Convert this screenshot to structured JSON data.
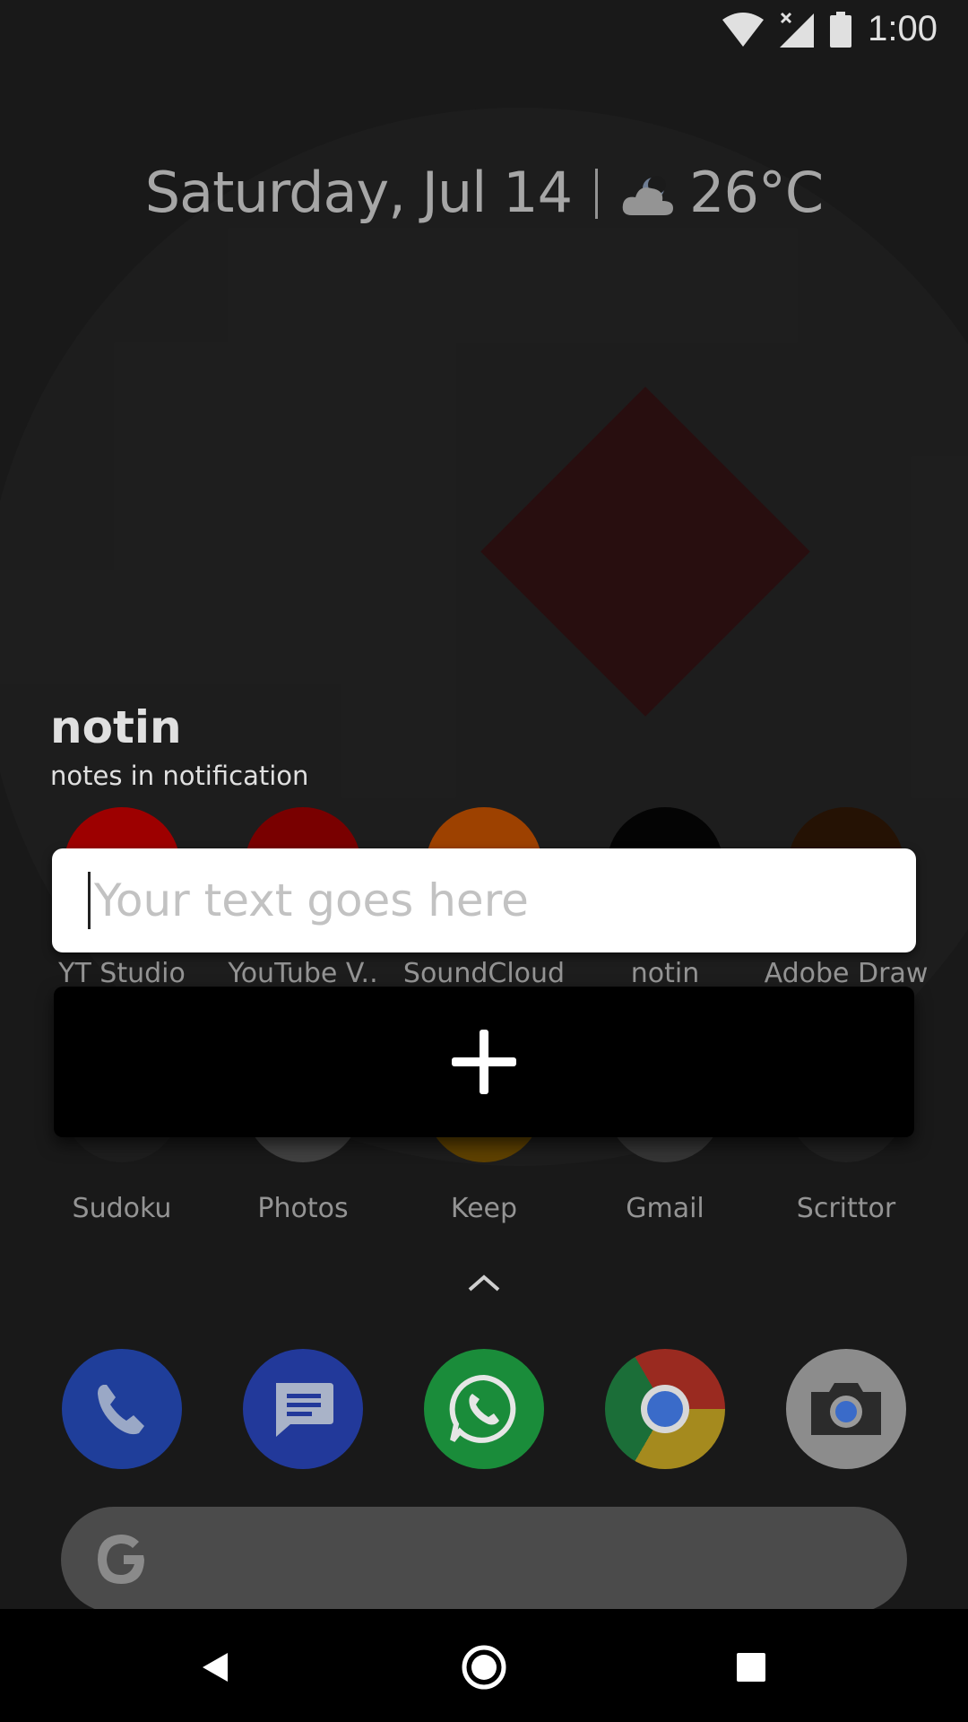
{
  "status_bar": {
    "time": "1:00",
    "icons": [
      "wifi-icon",
      "cellular-no-signal-icon",
      "battery-icon"
    ]
  },
  "at_a_glance": {
    "date": "Saturday, Jul 14",
    "weather_icon": "cloudy-night-icon",
    "temperature": "26°C"
  },
  "widget": {
    "title": "notin",
    "subtitle": "notes in notification",
    "input_placeholder": "Your text goes here",
    "input_value": "",
    "add_icon": "plus-icon"
  },
  "app_rows": [
    {
      "apps": [
        {
          "label": "YT Studio",
          "icon": "yt-studio-icon",
          "color": "#b30000"
        },
        {
          "label": "YouTube V..",
          "icon": "youtube-vanced-icon",
          "color": "#8a0000"
        },
        {
          "label": "SoundCloud",
          "icon": "soundcloud-icon",
          "color": "#b34a00"
        },
        {
          "label": "notin",
          "icon": "notin-icon",
          "color": "#050505"
        },
        {
          "label": "Adobe Draw",
          "icon": "adobe-draw-icon",
          "color": "#2b1505"
        }
      ]
    },
    {
      "apps": [
        {
          "label": "Sudoku",
          "icon": "sudoku-icon",
          "color": "#232323"
        },
        {
          "label": "Photos",
          "icon": "photos-icon",
          "color": "#4a4a4a"
        },
        {
          "label": "Keep",
          "icon": "keep-icon",
          "color": "#6b4a00"
        },
        {
          "label": "Gmail",
          "icon": "gmail-icon",
          "color": "#3d3d3d"
        },
        {
          "label": "Scrittor",
          "icon": "scrittor-icon",
          "color": "#262626"
        }
      ]
    }
  ],
  "app_drawer_handle_icon": "chevron-up-icon",
  "dock": [
    {
      "name": "phone",
      "icon": "phone-icon",
      "color": "#1f3e9a"
    },
    {
      "name": "messages",
      "icon": "messages-icon",
      "color": "#22399a"
    },
    {
      "name": "whatsapp",
      "icon": "whatsapp-icon",
      "color": "#1a8c3a"
    },
    {
      "name": "chrome",
      "icon": "chrome-icon",
      "color": "#1b6e38"
    },
    {
      "name": "camera",
      "icon": "camera-icon",
      "color": "#8c8c8c"
    }
  ],
  "search_bar": {
    "icon": "google-g-icon"
  },
  "nav_bar": {
    "back": "back-icon",
    "home": "home-icon",
    "recents": "recents-icon"
  }
}
